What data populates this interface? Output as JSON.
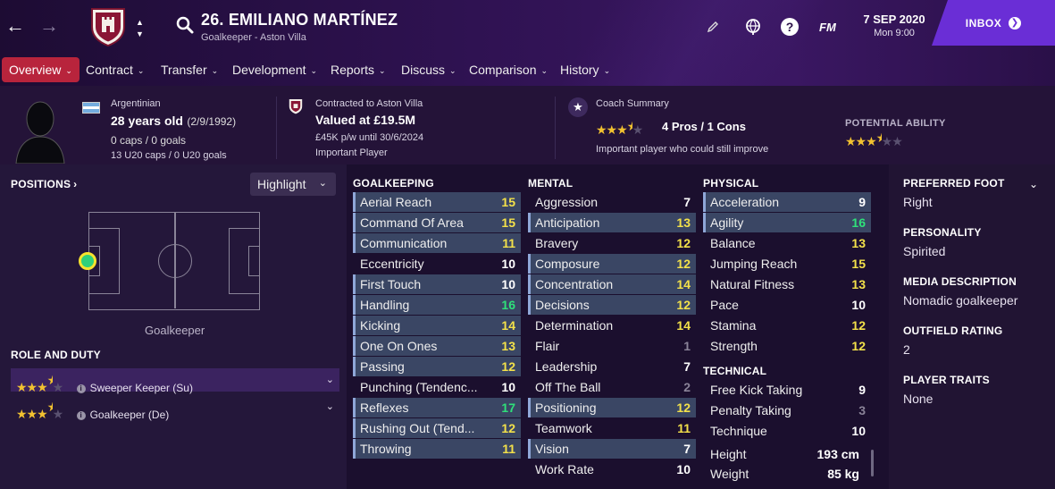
{
  "header": {
    "player_name": "26. EMILIANO MARTÍNEZ",
    "player_subtitle": "Goalkeeper - Aston Villa",
    "fm_label": "FM",
    "date": "7 SEP 2020",
    "time": "Mon 9:00",
    "inbox_label": "INBOX"
  },
  "tabs": [
    {
      "label": "Overview"
    },
    {
      "label": "Contract"
    },
    {
      "label": "Transfer"
    },
    {
      "label": "Development"
    },
    {
      "label": "Reports"
    },
    {
      "label": "Discuss"
    },
    {
      "label": "Comparison"
    },
    {
      "label": "History"
    }
  ],
  "info": {
    "nationality": "Argentinian",
    "age": "28 years old",
    "dob": "(2/9/1992)",
    "caps": "0 caps / 0 goals",
    "u20_caps": "13 U20 caps / 0 U20 goals",
    "contract_to": "Contracted to Aston Villa",
    "value": "Valued at £19.5M",
    "wage": "£45K p/w until 30/6/2024",
    "squad_status": "Important Player",
    "coach_title": "Coach Summary",
    "pros_cons": "4 Pros / 1 Cons",
    "coach_note": "Important player who could still improve",
    "coach_stars": 3.5,
    "potential_title": "POTENTIAL ABILITY",
    "potential_stars": 3.5
  },
  "positions": {
    "title": "POSITIONS",
    "highlight": "Highlight",
    "position_label": "Goalkeeper"
  },
  "roles": {
    "title": "ROLE AND DUTY",
    "items": [
      {
        "label": "Sweeper Keeper (Su)",
        "stars": 3.5
      },
      {
        "label": "Goalkeeper (De)",
        "stars": 3.5
      }
    ]
  },
  "goalkeeping": {
    "title": "GOALKEEPING",
    "items": [
      {
        "name": "Aerial Reach",
        "value": "15"
      },
      {
        "name": "Command Of Area",
        "value": "15"
      },
      {
        "name": "Communication",
        "value": "11"
      },
      {
        "name": "Eccentricity",
        "value": "10"
      },
      {
        "name": "First Touch",
        "value": "10"
      },
      {
        "name": "Handling",
        "value": "16"
      },
      {
        "name": "Kicking",
        "value": "14"
      },
      {
        "name": "One On Ones",
        "value": "13"
      },
      {
        "name": "Passing",
        "value": "12"
      },
      {
        "name": "Punching (Tendenc...",
        "value": "10"
      },
      {
        "name": "Reflexes",
        "value": "17"
      },
      {
        "name": "Rushing Out (Tend...",
        "value": "12"
      },
      {
        "name": "Throwing",
        "value": "11"
      }
    ]
  },
  "mental": {
    "title": "MENTAL",
    "items": [
      {
        "name": "Aggression",
        "value": "7"
      },
      {
        "name": "Anticipation",
        "value": "13"
      },
      {
        "name": "Bravery",
        "value": "12"
      },
      {
        "name": "Composure",
        "value": "12"
      },
      {
        "name": "Concentration",
        "value": "14"
      },
      {
        "name": "Decisions",
        "value": "12"
      },
      {
        "name": "Determination",
        "value": "14"
      },
      {
        "name": "Flair",
        "value": "1"
      },
      {
        "name": "Leadership",
        "value": "7"
      },
      {
        "name": "Off The Ball",
        "value": "2"
      },
      {
        "name": "Positioning",
        "value": "12"
      },
      {
        "name": "Teamwork",
        "value": "11"
      },
      {
        "name": "Vision",
        "value": "7"
      },
      {
        "name": "Work Rate",
        "value": "10"
      }
    ]
  },
  "physical": {
    "title": "PHYSICAL",
    "items": [
      {
        "name": "Acceleration",
        "value": "9"
      },
      {
        "name": "Agility",
        "value": "16"
      },
      {
        "name": "Balance",
        "value": "13"
      },
      {
        "name": "Jumping Reach",
        "value": "15"
      },
      {
        "name": "Natural Fitness",
        "value": "13"
      },
      {
        "name": "Pace",
        "value": "10"
      },
      {
        "name": "Stamina",
        "value": "12"
      },
      {
        "name": "Strength",
        "value": "12"
      }
    ]
  },
  "technical": {
    "title": "TECHNICAL",
    "items": [
      {
        "name": "Free Kick Taking",
        "value": "9"
      },
      {
        "name": "Penalty Taking",
        "value": "3"
      },
      {
        "name": "Technique",
        "value": "10"
      }
    ]
  },
  "measurements": {
    "height_label": "Height",
    "height": "193 cm",
    "weight_label": "Weight",
    "weight": "85 kg"
  },
  "details": {
    "preferred_foot_title": "PREFERRED FOOT",
    "preferred_foot": "Right",
    "personality_title": "PERSONALITY",
    "personality": "Spirited",
    "media_title": "MEDIA DESCRIPTION",
    "media": "Nomadic goalkeeper",
    "outfield_title": "OUTFIELD RATING",
    "outfield": "2",
    "traits_title": "PLAYER TRAITS",
    "traits": "None"
  },
  "colors": {
    "accent": "#b8243c",
    "inbox": "#6a2ed6",
    "highlight_row": "#3a4664",
    "value_yellow": "#f3e14a",
    "value_green": "#2fe07a"
  }
}
